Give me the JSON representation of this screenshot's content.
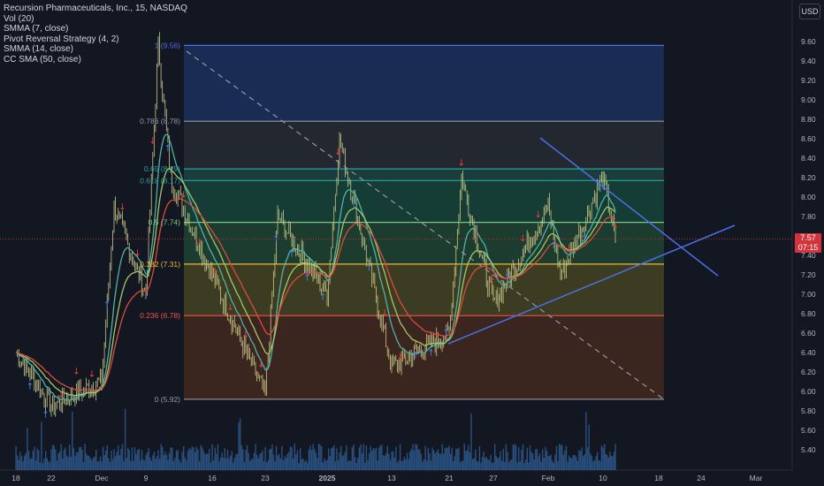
{
  "legend": {
    "title": "Recursion Pharmaceuticals, Inc., 15, NASDAQ",
    "items": [
      "Vol (20)",
      "SMMA (7, close)",
      "Pivot Reversal Strategy (4, 2)",
      "SMMA (14, close)",
      "CC SMA (50, close)"
    ]
  },
  "currency_button": "USD",
  "last_price": {
    "value": "7.57",
    "countdown": "07:15",
    "color": "#d1343d"
  },
  "colors": {
    "background": "#131722",
    "candles": "#c9c98a",
    "smma_fast": "#4fb3a6",
    "smma_slow": "#a6c56a",
    "sma50": "#e04a3c",
    "trendline": "#4c6ee8",
    "volume": "#2f5f96",
    "signal_up": "#3d8bff",
    "signal_down": "#ff3b3b"
  },
  "chart_data": {
    "type": "candlestick",
    "symbol": "Recursion Pharmaceuticals, Inc., 15, NASDAQ",
    "y_axis_ticks": [
      "9.60",
      "9.40",
      "9.20",
      "9.00",
      "8.80",
      "8.60",
      "8.40",
      "8.20",
      "8.00",
      "7.80",
      "7.60",
      "7.40",
      "7.20",
      "7.00",
      "6.80",
      "6.60",
      "6.40",
      "6.20",
      "6.00",
      "5.80",
      "5.60",
      "5.40"
    ],
    "x_axis_ticks": [
      "18",
      "22",
      "Dec",
      "9",
      "16",
      "23",
      "2025",
      "13",
      "21",
      "27",
      "Feb",
      "10",
      "18",
      "24",
      "Mar"
    ],
    "ylim": [
      5.3,
      9.75
    ],
    "fib_levels": [
      {
        "label": "1 (9.56)",
        "price": 9.56,
        "color": "#4c6ee8"
      },
      {
        "label": "0.786 (8.78)",
        "price": 8.78,
        "color": "#9598a1"
      },
      {
        "label": "0.65 (8.29)",
        "price": 8.29,
        "color": "#26a69a"
      },
      {
        "label": "0.618 (8.17)",
        "price": 8.17,
        "color": "#26a69a"
      },
      {
        "label": "0.5 (7.74)",
        "price": 7.74,
        "color": "#81c784"
      },
      {
        "label": "0.382 (7.31)",
        "price": 7.31,
        "color": "#f0b73a"
      },
      {
        "label": "0.236 (6.78)",
        "price": 6.78,
        "color": "#ef5350"
      },
      {
        "label": "0 (5.92)",
        "price": 5.92,
        "color": "#9598a1"
      }
    ],
    "price_path": [
      {
        "x": "18",
        "y": 6.4
      },
      {
        "x": "22",
        "y": 5.85
      },
      {
        "x": "Dec",
        "y": 6.1
      },
      {
        "x": "Dec",
        "y": 7.9
      },
      {
        "x": "9",
        "y": 7.0
      },
      {
        "x": "9",
        "y": 9.56
      },
      {
        "x": "9",
        "y": 8.2
      },
      {
        "x": "16",
        "y": 7.2
      },
      {
        "x": "23",
        "y": 5.95
      },
      {
        "x": "23",
        "y": 7.8
      },
      {
        "x": "2025",
        "y": 7.0
      },
      {
        "x": "2025",
        "y": 8.6
      },
      {
        "x": "13",
        "y": 6.25
      },
      {
        "x": "21",
        "y": 6.6
      },
      {
        "x": "21",
        "y": 8.2
      },
      {
        "x": "27",
        "y": 6.9
      },
      {
        "x": "Feb",
        "y": 7.9
      },
      {
        "x": "Feb",
        "y": 7.2
      },
      {
        "x": "10",
        "y": 8.2
      },
      {
        "x": "10",
        "y": 7.57
      }
    ],
    "last_close": 7.57
  }
}
